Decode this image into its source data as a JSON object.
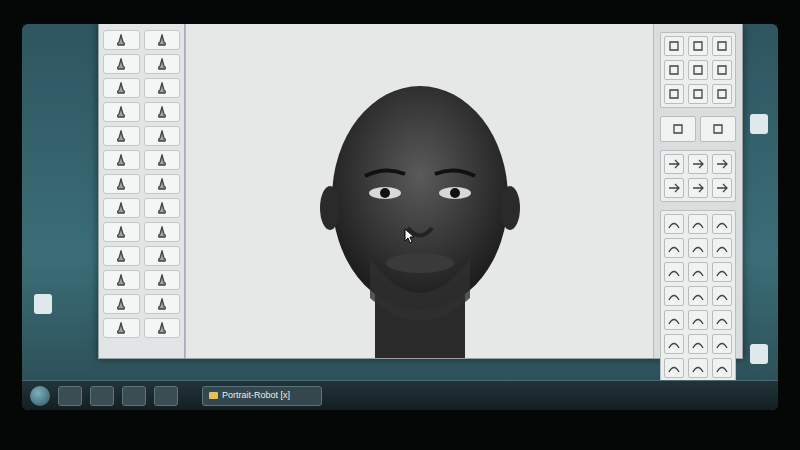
{
  "taskbar": {
    "tasks": [
      {
        "label": "Portrait-Robot [x]",
        "selected": true
      }
    ]
  }
}
